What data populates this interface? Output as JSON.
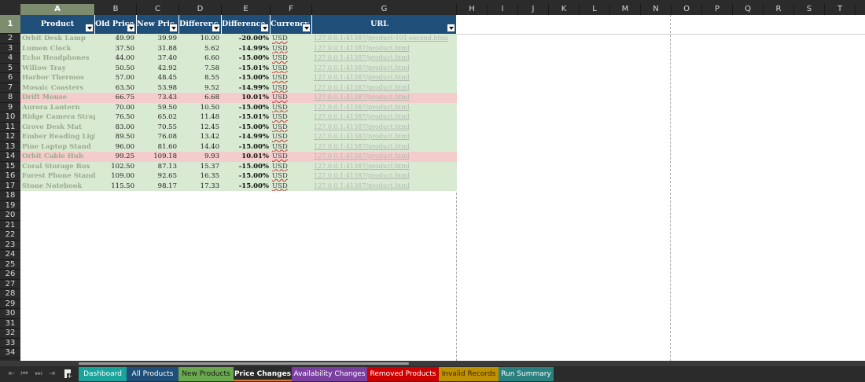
{
  "columns": [
    "A",
    "B",
    "C",
    "D",
    "E",
    "F",
    "G",
    "H",
    "I",
    "J",
    "K",
    "L",
    "M",
    "N",
    "O",
    "P",
    "Q",
    "R",
    "S",
    "T"
  ],
  "selected_column": "A",
  "selected_row": "1",
  "table": {
    "headers": [
      "Product",
      "Old Price",
      "New Pric",
      "Differenc",
      "Difference",
      "Currency",
      "URL"
    ],
    "rows": [
      {
        "product": "Orbit Desk Lamp",
        "old": "49.99",
        "new": "39.99",
        "diff": "10.00",
        "pct": "-20.00%",
        "cur": "USD",
        "url": "127.0.0.1:41387/product-101-second.html",
        "status": "ok"
      },
      {
        "product": "Lumen Clock",
        "old": "37.50",
        "new": "31.88",
        "diff": "5.62",
        "pct": "-14.99%",
        "cur": "USD",
        "url": "127.0.0.1:41387/product.html",
        "status": "ok"
      },
      {
        "product": "Echo Headphones",
        "old": "44.00",
        "new": "37.40",
        "diff": "6.60",
        "pct": "-15.00%",
        "cur": "USD",
        "url": "127.0.0.1:41387/product.html",
        "status": "ok"
      },
      {
        "product": "Willow Tray",
        "old": "50.50",
        "new": "42.92",
        "diff": "7.58",
        "pct": "-15.01%",
        "cur": "USD",
        "url": "127.0.0.1:41387/product.html",
        "status": "ok"
      },
      {
        "product": "Harbor Thermos",
        "old": "57.00",
        "new": "48.45",
        "diff": "8.55",
        "pct": "-15.00%",
        "cur": "USD",
        "url": "127.0.0.1:41387/product.html",
        "status": "ok"
      },
      {
        "product": "Mosaic Coasters",
        "old": "63.50",
        "new": "53.98",
        "diff": "9.52",
        "pct": "-14.99%",
        "cur": "USD",
        "url": "127.0.0.1:41387/product.html",
        "status": "ok"
      },
      {
        "product": "Drift Mouse",
        "old": "66.75",
        "new": "73.43",
        "diff": "6.68",
        "pct": "10.01%",
        "cur": "USD",
        "url": "127.0.0.1:41387/product.html",
        "status": "up"
      },
      {
        "product": "Aurora Lantern",
        "old": "70.00",
        "new": "59.50",
        "diff": "10.50",
        "pct": "-15.00%",
        "cur": "USD",
        "url": "127.0.0.1:41387/product.html",
        "status": "ok"
      },
      {
        "product": "Ridge Camera Strap",
        "old": "76.50",
        "new": "65.02",
        "diff": "11.48",
        "pct": "-15.01%",
        "cur": "USD",
        "url": "127.0.0.1:41387/product.html",
        "status": "ok"
      },
      {
        "product": "Grove Desk Mat",
        "old": "83.00",
        "new": "70.55",
        "diff": "12.45",
        "pct": "-15.00%",
        "cur": "USD",
        "url": "127.0.0.1:41387/product.html",
        "status": "ok"
      },
      {
        "product": "Ember Reading Light",
        "old": "89.50",
        "new": "76.08",
        "diff": "13.42",
        "pct": "-14.99%",
        "cur": "USD",
        "url": "127.0.0.1:41387/product.html",
        "status": "ok"
      },
      {
        "product": "Pine Laptop Stand",
        "old": "96.00",
        "new": "81.60",
        "diff": "14.40",
        "pct": "-15.00%",
        "cur": "USD",
        "url": "127.0.0.1:41387/product.html",
        "status": "ok"
      },
      {
        "product": "Orbit Cable Hub",
        "old": "99.25",
        "new": "109.18",
        "diff": "9.93",
        "pct": "10.01%",
        "cur": "USD",
        "url": "127.0.0.1:41387/product.html",
        "status": "up"
      },
      {
        "product": "Coral Storage Box",
        "old": "102.50",
        "new": "87.13",
        "diff": "15.37",
        "pct": "-15.00%",
        "cur": "USD",
        "url": "127.0.0.1:41387/product.html",
        "status": "ok"
      },
      {
        "product": "Forest Phone Stand",
        "old": "109.00",
        "new": "92.65",
        "diff": "16.35",
        "pct": "-15.00%",
        "cur": "USD",
        "url": "127.0.0.1:41387/product.html",
        "status": "ok"
      },
      {
        "product": "Stone Notebook",
        "old": "115.50",
        "new": "98.17",
        "diff": "17.33",
        "pct": "-15.00%",
        "cur": "USD",
        "url": "127.0.0.1:41387/product.html",
        "status": "ok"
      }
    ]
  },
  "colors": {
    "header_bg": "#1f4e79",
    "row_ok": "#d9ead3",
    "row_up": "#f4cccc"
  },
  "sheet_tabs": [
    {
      "label": "Dashboard",
      "color": "#1aa39a",
      "text": "#ffffff"
    },
    {
      "label": "All Products",
      "color": "#1f4e79",
      "text": "#ffffff"
    },
    {
      "label": "New Products",
      "color": "#6aa84f",
      "text": "#1a1a1a"
    },
    {
      "label": "Price Changes",
      "color": "#2b2b2b",
      "text": "#ffffff",
      "active": true
    },
    {
      "label": "Availability Changes",
      "color": "#7b3fa0",
      "text": "#ffffff"
    },
    {
      "label": "Removed Products",
      "color": "#cc0000",
      "text": "#ffffff"
    },
    {
      "label": "Invalid Records",
      "color": "#bf9000",
      "text": "#3a2a00"
    },
    {
      "label": "Run Summary",
      "color": "#2a7f7f",
      "text": "#ffffff"
    }
  ],
  "nav_icons": [
    "first-sheet-icon",
    "prev-sheet-icon",
    "next-sheet-icon",
    "last-sheet-icon"
  ]
}
